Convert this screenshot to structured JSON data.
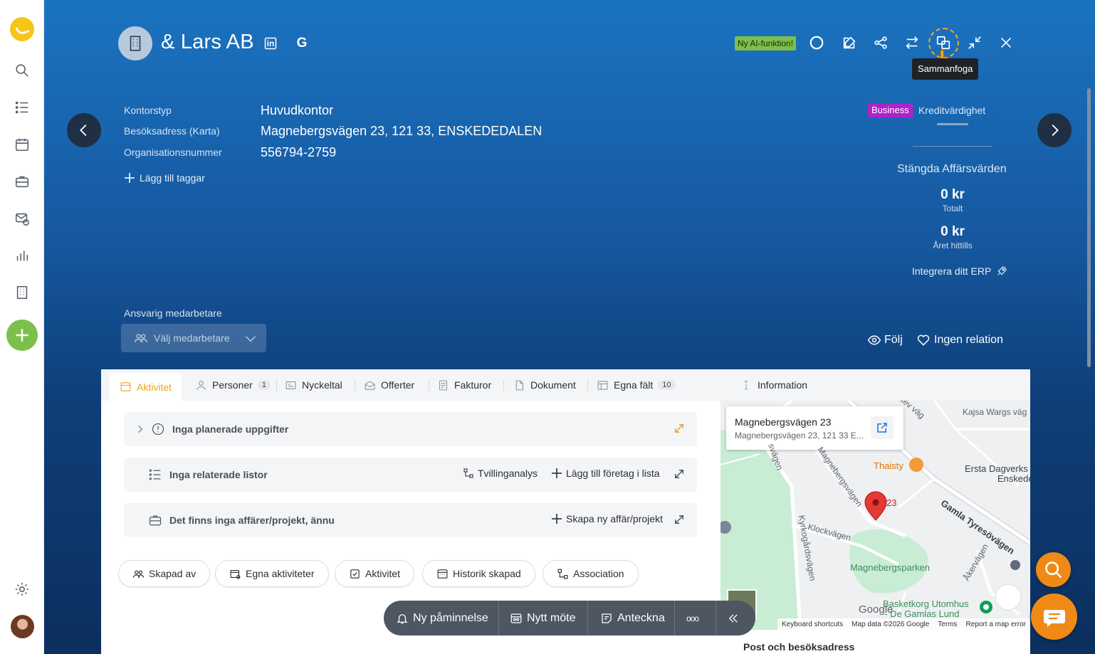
{
  "company": {
    "name": "& Lars AB",
    "linkedin_label": "in",
    "google_label": "G"
  },
  "toolbar": {
    "ai_badge": "Ny AI-funktion!",
    "tooltip": "Sammanfoga"
  },
  "info": {
    "fields": [
      {
        "label": "Kontorstyp",
        "value": "Huvudkontor"
      },
      {
        "label": "Besöksadress (Karta)",
        "value": "Magnebergsvägen 23, 121 33, ENSKEDEDALEN"
      },
      {
        "label": "Organisationsnummer",
        "value": "556794-2759"
      }
    ],
    "add_tags": "Lägg till taggar"
  },
  "side": {
    "business_badge": "Business",
    "kredit": "Kreditvärdighet",
    "closed_title": "Stängda Affärsvärden",
    "total_value": "0 kr",
    "total_label": "Totalt",
    "ytd_value": "0 kr",
    "ytd_label": "Året hittills",
    "erp": "Integrera ditt ERP"
  },
  "responsible": {
    "label": "Ansvarig medarbetare",
    "placeholder": "Välj medarbetare"
  },
  "follow": {
    "follow_label": "Följ",
    "relation_label": "Ingen relation"
  },
  "tabs": [
    {
      "label": "Aktivitet"
    },
    {
      "label": "Personer",
      "count": "1"
    },
    {
      "label": "Nyckeltal"
    },
    {
      "label": "Offerter"
    },
    {
      "label": "Fakturor"
    },
    {
      "label": "Dokument"
    },
    {
      "label": "Egna fält",
      "count": "10"
    }
  ],
  "rows": {
    "tasks": "Inga planerade uppgifter",
    "lists": "Inga relaterade listor",
    "twin": "Tvillinganalys",
    "add_to_list": "Lägg till företag i lista",
    "deals": "Det finns inga affärer/projekt, ännu",
    "create_deal": "Skapa ny affär/projekt"
  },
  "chips": [
    "Skapad av",
    "Egna aktiviteter",
    "Aktivitet",
    "Historik skapad",
    "Association"
  ],
  "right_panel": {
    "title": "Information",
    "map_card_title": "Magnebergsvägen 23",
    "map_card_sub": "Magnebergsvägen 23, 121 33 E...",
    "map_labels": {
      "kajsa": "Kajsa Wargs väg",
      "thaisty": "Thaisty",
      "ersta1": "Ersta Dagverks",
      "ersta2": "Enskede",
      "gamla": "Gamla Tyresövägen",
      "klock": "Klockvägen",
      "kyrk": "Kyrkogårdsvägen",
      "magneberg_road": "Magnebergsvägen",
      "parken": "Magnebergsparken",
      "basket1": "Basketkorg Utomhus",
      "basket2": "- De Gamlas Lund",
      "ake": "Åkervägen",
      "pin_num": "23",
      "ede": "edev väg",
      "svagen": "svägen",
      "google": "Google"
    },
    "map_footer": [
      "Keyboard shortcuts",
      "Map data ©2026 Google",
      "Terms",
      "Report a map error"
    ],
    "footer_title": "Post och besöksadress"
  },
  "bottom_bar": {
    "reminder": "Ny påminnelse",
    "meeting": "Nytt möte",
    "note": "Anteckna",
    "more": "ooo"
  },
  "colors": {
    "accent": "#e8a41a",
    "ai_badge": "#7cc04b",
    "business": "#b022c9",
    "fab": "#f08a16"
  }
}
